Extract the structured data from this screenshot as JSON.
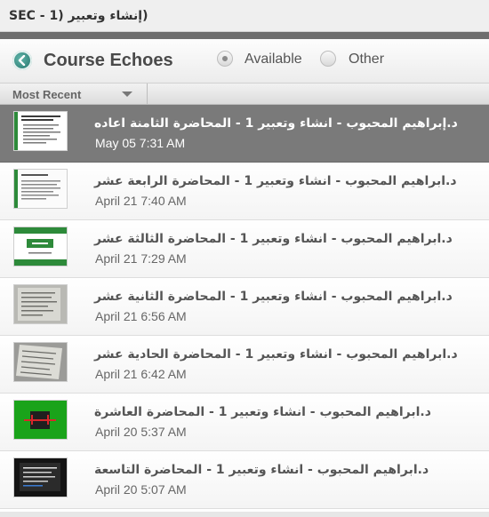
{
  "window": {
    "title": "SEC - 1) إنشاء وتعبير)"
  },
  "header": {
    "app_title": "Course Echoes",
    "logo_icon": "echo-logo-icon",
    "filter": {
      "available_label": "Available",
      "other_label": "Other",
      "selected": "available"
    }
  },
  "sort": {
    "label": "Most Recent"
  },
  "echoes": [
    {
      "title": "د.إبراهيم المحبوب - انشاء وتعبير 1 - المحاضرة الثامنة اعاده",
      "date": "May 05 7:31 AM",
      "thumb_style": "slide-bullets",
      "selected": true
    },
    {
      "title": "د.ابراهيم المحبوب - انشاء وتعبير 1 - المحاضرة الرابعة عشر",
      "date": "April 21 7:40 AM",
      "thumb_style": "slide-text"
    },
    {
      "title": "د.ابراهيم المحبوب - انشاء وتعبير 1 - المحاضرة الثالثة عشر",
      "date": "April 21 7:29 AM",
      "thumb_style": "slide-green-title"
    },
    {
      "title": "د.ابراهيم المحبوب - انشاء وتعبير 1 - المحاضرة الثانية عشر",
      "date": "April 21 6:56 AM",
      "thumb_style": "photo-document"
    },
    {
      "title": "د.ابراهيم المحبوب - انشاء وتعبير 1 - المحاضرة الحادية عشر",
      "date": "April 21 6:42 AM",
      "thumb_style": "photo-document-angled"
    },
    {
      "title": "د.ابراهيم المحبوب - انشاء وتعبير 1 - المحاضرة العاشرة",
      "date": "April 20 5:37 AM",
      "thumb_style": "green-screen"
    },
    {
      "title": "د.ابراهيم المحبوب - انشاء وتعبير 1 - المحاضرة التاسعة",
      "date": "April 20 5:07 AM",
      "thumb_style": "dark-slide"
    }
  ]
}
